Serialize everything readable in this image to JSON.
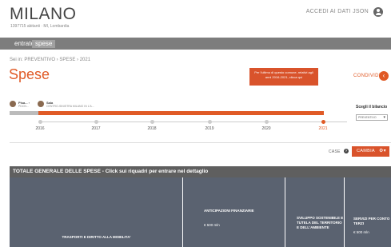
{
  "header": {
    "city": "MILANO",
    "subtitle": "1397715 abitanti · MI, Lombardia",
    "login_label": "ACCEDI AI DATI JSON"
  },
  "tabs": [
    {
      "label": "entrate",
      "active": false
    },
    {
      "label": "spese",
      "active": true
    }
  ],
  "main": {
    "breadcrumb": "Sei in: PREVENTIVO › SPESE › 2021",
    "title": "Spese",
    "alert_text": "Per l'ultimo di questo comune, relativi agli anni 2016-2021, clicca qui",
    "share_label": "CONDIVIDI"
  },
  "administrations": [
    {
      "name": "Pisa... ›",
      "sub": "PDCN..."
    },
    {
      "name": "Sala",
      "sub": "CENTRO-SINISTRA MILANO IN L'A..."
    }
  ],
  "bilancio": {
    "label": "Scegli il bilancio",
    "selected": "PREVENTIVO"
  },
  "timeline": {
    "years": [
      "2016",
      "2017",
      "2018",
      "2019",
      "2020",
      "2021"
    ],
    "active_index": 5
  },
  "controls": {
    "caselle_label": "CASE",
    "help_icon": "?",
    "cambia_label": "CAMBIA"
  },
  "total_header": "TOTALE GENERALE DELLE SPESE - Click sui riquadri per entrare nel dettaglio",
  "tiles": [
    {
      "label": "TRASPORTI E DIRITTO ALLA MOBILITA'",
      "amount": ""
    },
    {
      "label": "ANTICIPAZIONI FINANZIARIE",
      "amount": "€ 500 mln"
    },
    {
      "label": "SVILUPPO SOSTENIBILE E TUTELA DEL TERRITORIO E DELL'AMBIENTE",
      "amount": ""
    },
    {
      "label": "SERVIZI PER CONTO TERZI",
      "amount": "€ 500 mln"
    }
  ],
  "colors": {
    "accent": "#e05a26",
    "tab_bar": "#7d7d7d",
    "tile": "#5a6270",
    "header_bar": "#5f5f5f"
  }
}
